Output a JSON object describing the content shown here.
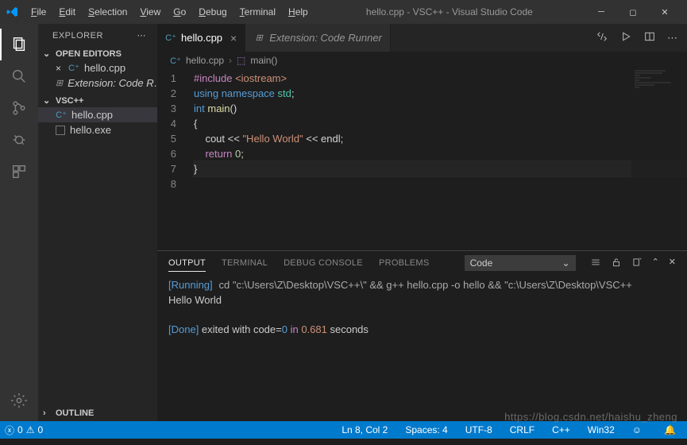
{
  "titlebar": {
    "menus": [
      "File",
      "Edit",
      "Selection",
      "View",
      "Go",
      "Debug",
      "Terminal",
      "Help"
    ],
    "title": "hello.cpp - VSC++ - Visual Studio Code"
  },
  "sidebar": {
    "title": "EXPLORER",
    "openEditors": {
      "header": "OPEN EDITORS",
      "items": [
        {
          "label": "hello.cpp",
          "icon": "cpp",
          "close": true
        },
        {
          "label": "Extension: Code R…",
          "icon": "ext",
          "italic": true
        }
      ]
    },
    "project": {
      "header": "VSC++",
      "items": [
        {
          "label": "hello.cpp",
          "icon": "cpp",
          "selected": true
        },
        {
          "label": "hello.exe",
          "icon": "exe"
        }
      ]
    },
    "outline": {
      "header": "OUTLINE"
    }
  },
  "tabs": [
    {
      "label": "hello.cpp",
      "icon": "cpp",
      "active": true
    },
    {
      "label": "Extension: Code Runner",
      "icon": "ext",
      "italic": true
    }
  ],
  "breadcrumb": {
    "file": "hello.cpp",
    "symbol": "main()"
  },
  "code": {
    "lines": [
      {
        "n": 1,
        "html": "<span class='kw'>#include</span> <span class='st'>&lt;iostream&gt;</span>"
      },
      {
        "n": 2,
        "html": "<span class='kw2'>using</span> <span class='kw2'>namespace</span> <span class='ns'>std</span>;"
      },
      {
        "n": 3,
        "html": ""
      },
      {
        "n": 4,
        "html": "<span class='ty'>int</span> <span class='fn'>main</span>()"
      },
      {
        "n": 5,
        "html": "{"
      },
      {
        "n": 6,
        "html": "    cout &lt;&lt; <span class='st'>\"Hello World\"</span> &lt;&lt; endl;"
      },
      {
        "n": 7,
        "html": "    <span class='kw'>return</span> <span class='nm'>0</span>;"
      },
      {
        "n": 8,
        "html": "}",
        "cursor": true
      }
    ]
  },
  "panel": {
    "tabs": [
      "OUTPUT",
      "TERMINAL",
      "DEBUG CONSOLE",
      "PROBLEMS"
    ],
    "active": "OUTPUT",
    "filter": "Code",
    "running_label": "[Running]",
    "running_cmd": "cd \"c:\\Users\\Z\\Desktop\\VSC++\\\" && g++ hello.cpp -o hello && \"c:\\Users\\Z\\Desktop\\VSC++",
    "stdout": "Hello World",
    "done_label": "[Done]",
    "done_text": " exited with code=",
    "done_code": "0",
    "done_in": " in ",
    "done_time": "0.681",
    "done_sec": " seconds"
  },
  "status": {
    "errors": "0",
    "warnings": "0",
    "ln": "Ln 8, Col 2",
    "spaces": "Spaces: 4",
    "enc": "UTF-8",
    "eol": "CRLF",
    "lang": "C++",
    "target": "Win32"
  },
  "watermark": "https://blog.csdn.net/haishu_zheng"
}
